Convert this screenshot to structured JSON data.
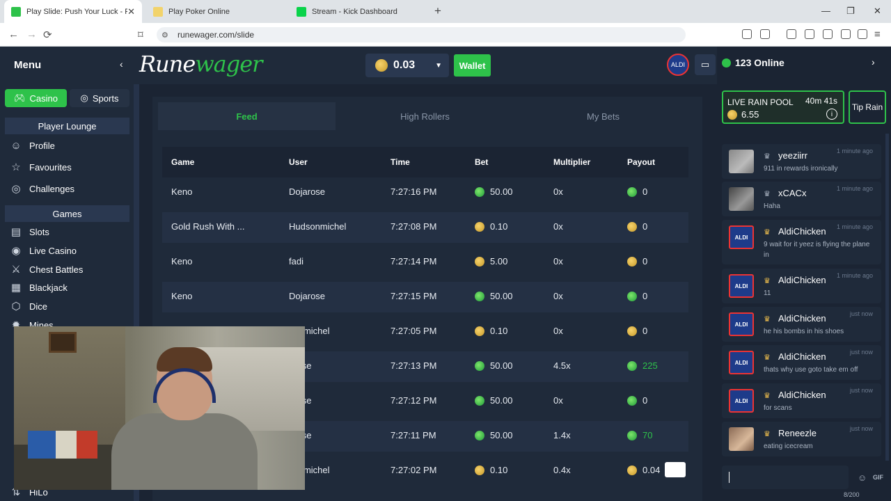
{
  "browser": {
    "tabs": [
      {
        "title": "Play Slide: Push Your Luck - Rune",
        "active": true
      },
      {
        "title": "Play Poker Online",
        "active": false
      },
      {
        "title": "Stream - Kick Dashboard",
        "active": false
      }
    ],
    "new_tab": "+",
    "url": "runewager.com/slide",
    "win_min": "—",
    "win_max": "❐",
    "win_close": "✕",
    "tab_close": "✕"
  },
  "sidebar": {
    "title": "Menu",
    "back": "‹",
    "casino_label": "Casino",
    "sports_label": "Sports",
    "lounge_header": "Player Lounge",
    "lounge_items": [
      {
        "label": "Profile",
        "icon": "profile-icon"
      },
      {
        "label": "Favourites",
        "icon": "star-icon"
      },
      {
        "label": "Challenges",
        "icon": "challenges-icon"
      }
    ],
    "games_header": "Games",
    "game_items": [
      {
        "label": "Slots",
        "icon": "slots-icon"
      },
      {
        "label": "Live Casino",
        "icon": "live-icon"
      },
      {
        "label": "Chest Battles",
        "icon": "swords-icon"
      },
      {
        "label": "Blackjack",
        "icon": "cards-icon"
      },
      {
        "label": "Dice",
        "icon": "dice-icon"
      },
      {
        "label": "Mines",
        "icon": "mines-icon"
      }
    ],
    "bottom_item": "HiLo"
  },
  "header": {
    "logo_main": "Rune",
    "logo_accent": "wager",
    "balance": "0.03",
    "wallet_label": "Wallet",
    "avatar_text": "ALDI"
  },
  "feed": {
    "tabs": [
      "Feed",
      "High Rollers",
      "My Bets"
    ],
    "active_tab": 0,
    "columns": [
      "Game",
      "User",
      "Time",
      "Bet",
      "Multiplier",
      "Payout"
    ],
    "rows": [
      {
        "game": "Keno",
        "user": "Dojarose",
        "time": "7:27:16 PM",
        "bet": "50.00",
        "mult": "0x",
        "payout": "0",
        "coin": "gem",
        "win": false
      },
      {
        "game": "Gold Rush With ...",
        "user": "Hudsonmichel",
        "time": "7:27:08 PM",
        "bet": "0.10",
        "mult": "0x",
        "payout": "0",
        "coin": "gold",
        "win": false
      },
      {
        "game": "Keno",
        "user": "fadi",
        "time": "7:27:14 PM",
        "bet": "5.00",
        "mult": "0x",
        "payout": "0",
        "coin": "gold",
        "win": false
      },
      {
        "game": "Keno",
        "user": "Dojarose",
        "time": "7:27:15 PM",
        "bet": "50.00",
        "mult": "0x",
        "payout": "0",
        "coin": "gem",
        "win": false
      },
      {
        "game": "",
        "user": "sonmichel",
        "time": "7:27:05 PM",
        "bet": "0.10",
        "mult": "0x",
        "payout": "0",
        "coin": "gold",
        "win": false
      },
      {
        "game": "",
        "user": "arose",
        "time": "7:27:13 PM",
        "bet": "50.00",
        "mult": "4.5x",
        "payout": "225",
        "coin": "gem",
        "win": true
      },
      {
        "game": "",
        "user": "arose",
        "time": "7:27:12 PM",
        "bet": "50.00",
        "mult": "0x",
        "payout": "0",
        "coin": "gem",
        "win": false
      },
      {
        "game": "",
        "user": "arose",
        "time": "7:27:11 PM",
        "bet": "50.00",
        "mult": "1.4x",
        "payout": "70",
        "coin": "gem",
        "win": true
      },
      {
        "game": "",
        "user": "sonmichel",
        "time": "7:27:02 PM",
        "bet": "0.10",
        "mult": "0.4x",
        "payout": "0.04",
        "coin": "gold",
        "win": false
      }
    ]
  },
  "chat": {
    "online": "123 Online",
    "arrow": "›",
    "rain_label": "LIVE RAIN POOL",
    "rain_timer": "40m 41s",
    "rain_amount": "6.55",
    "tip_rain": "Tip Rain",
    "messages": [
      {
        "user": "yeeziirr",
        "time": "1 minute ago",
        "text": "911 in rewards ironically",
        "avatar": "photo1",
        "badge": "gray"
      },
      {
        "user": "xCACx",
        "time": "1 minute ago",
        "text": "Haha",
        "avatar": "photo2",
        "badge": "gray"
      },
      {
        "user": "AldiChicken",
        "time": "1 minute ago",
        "text": "9 wait for it yeez is flying the plane in",
        "avatar": "aldi",
        "badge": "gold"
      },
      {
        "user": "AldiChicken",
        "time": "1 minute ago",
        "text": "11",
        "avatar": "aldi",
        "badge": "gold"
      },
      {
        "user": "AldiChicken",
        "time": "just now",
        "text": "he his bombs in his shoes",
        "avatar": "aldi",
        "badge": "gold"
      },
      {
        "user": "AldiChicken",
        "time": "just now",
        "text": "thats why use goto take em off",
        "avatar": "aldi",
        "badge": "gold"
      },
      {
        "user": "AldiChicken",
        "time": "just now",
        "text": "for scans",
        "avatar": "aldi",
        "badge": "gold"
      },
      {
        "user": "Reneezle",
        "time": "just now",
        "text": "eating icecream",
        "avatar": "photo3",
        "badge": "gold"
      }
    ],
    "gif_label": "GIF",
    "char_count": "8/200"
  },
  "colors": {
    "accent": "#2ec24a",
    "bg": "#1b2433",
    "panel": "#1f2a3a"
  }
}
